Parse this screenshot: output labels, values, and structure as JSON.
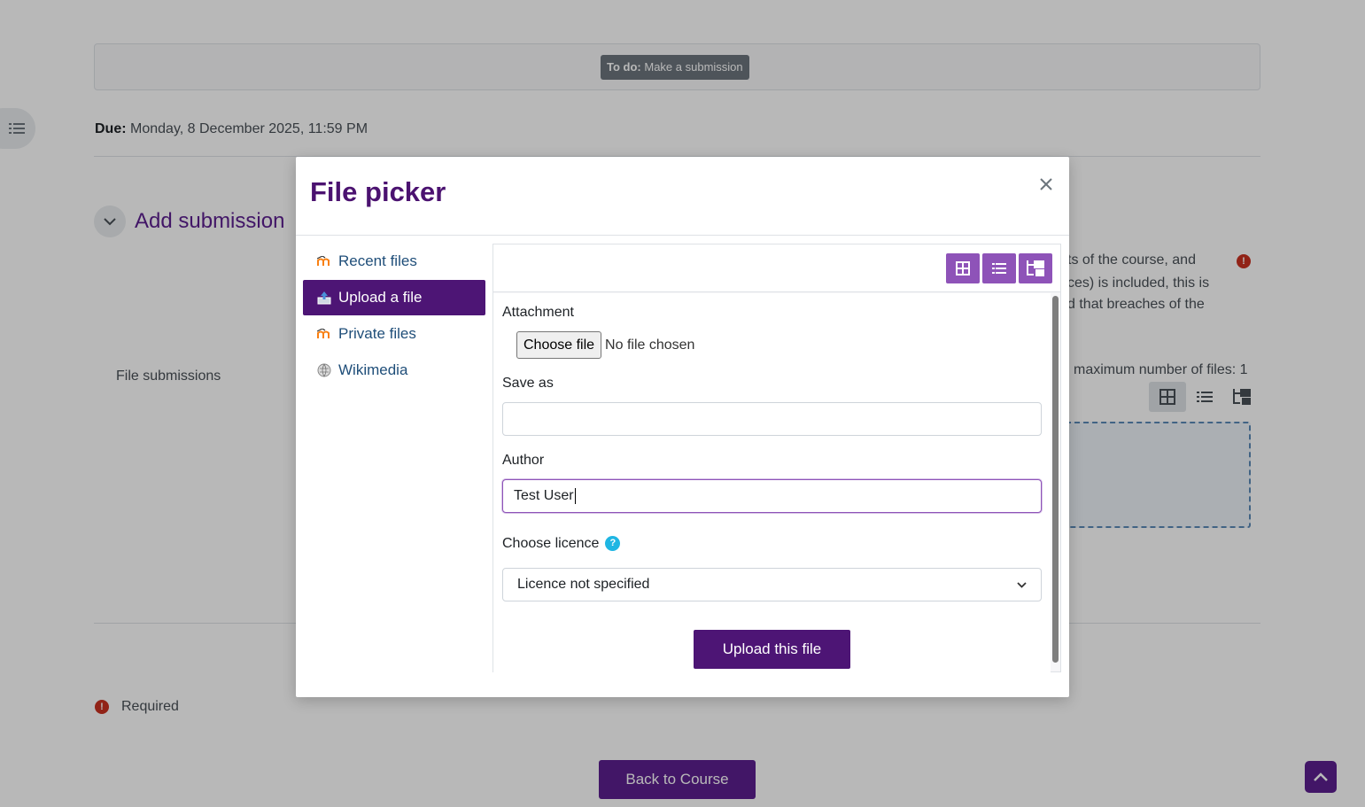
{
  "background": {
    "todo_label": "To do:",
    "todo_text": "Make a submission",
    "due_label": "Due:",
    "due_value": "Monday, 8 December 2025, 11:59 PM",
    "section_title": "Add submission",
    "partial_text_lines": [
      "ts of the course, and",
      "ces) is included, this is",
      "d that breaches of the"
    ],
    "file_submissions_label": "File submissions",
    "max_files_text": "maximum number of files: 1",
    "required_text": "Required",
    "back_button": "Back to Course"
  },
  "modal": {
    "title": "File picker",
    "close_icon": "close-icon",
    "repositories": [
      {
        "label": "Recent files",
        "icon": "moodle-icon",
        "active": false
      },
      {
        "label": "Upload a file",
        "icon": "upload-icon",
        "active": true
      },
      {
        "label": "Private files",
        "icon": "moodle-icon",
        "active": false
      },
      {
        "label": "Wikimedia",
        "icon": "wikimedia-icon",
        "active": false
      }
    ],
    "view_buttons": [
      "grid-view-icon",
      "list-view-icon",
      "tree-view-icon"
    ],
    "form": {
      "attachment_label": "Attachment",
      "choose_file_button": "Choose file",
      "no_file_text": "No file chosen",
      "save_as_label": "Save as",
      "save_as_value": "",
      "author_label": "Author",
      "author_value": "Test User",
      "licence_label": "Choose licence",
      "licence_selected": "Licence not specified",
      "upload_button": "Upload this file"
    }
  },
  "colors": {
    "brand_purple": "#5c1f8f",
    "active_nav": "#4d1575",
    "view_button": "#8e53b8",
    "required_red": "#ca3120",
    "help_blue": "#1fb6e3"
  }
}
